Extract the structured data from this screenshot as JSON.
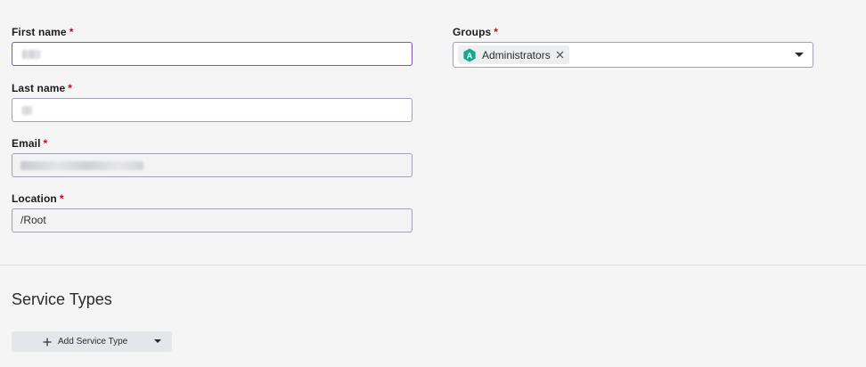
{
  "form": {
    "first_name": {
      "label": "First name",
      "required_mark": "*",
      "value": ""
    },
    "last_name": {
      "label": "Last name",
      "required_mark": "*",
      "value": ""
    },
    "email": {
      "label": "Email",
      "required_mark": "*",
      "value": ""
    },
    "location": {
      "label": "Location",
      "required_mark": "*",
      "value": "/Root"
    },
    "groups": {
      "label": "Groups",
      "required_mark": "*",
      "chips": [
        {
          "initial": "A",
          "label": "Administrators",
          "color": "#14a88a"
        }
      ]
    }
  },
  "service_types": {
    "title": "Service Types",
    "add_button_label": "Add Service Type"
  },
  "icons": {
    "chip_avatar": "hexagon-avatar-icon",
    "chip_remove": "close-icon",
    "groups_toggle": "caret-down-icon",
    "add": "plus-icon",
    "add_menu": "caret-down-icon"
  },
  "colors": {
    "focus_border": "#7b55c7",
    "required": "#d0021b",
    "chip_avatar": "#14a88a"
  }
}
